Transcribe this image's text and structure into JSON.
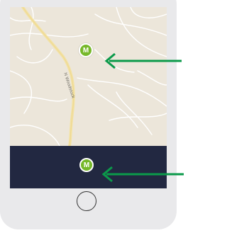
{
  "map": {
    "road_label": "N Woodstock",
    "marker_letter": "M",
    "marker_icon": "metro-station-marker-icon"
  },
  "bottom_bar": {
    "marker_letter": "M",
    "marker_icon": "metro-station-marker-icon"
  },
  "colors": {
    "marker_green": "#76b82a",
    "bar_navy": "#222841",
    "arrow_green": "#0b9a4a",
    "map_bg": "#ece6da"
  },
  "annotation_arrows": [
    "arrow-left-icon",
    "arrow-left-icon"
  ],
  "home_button_icon": "home-button-icon"
}
